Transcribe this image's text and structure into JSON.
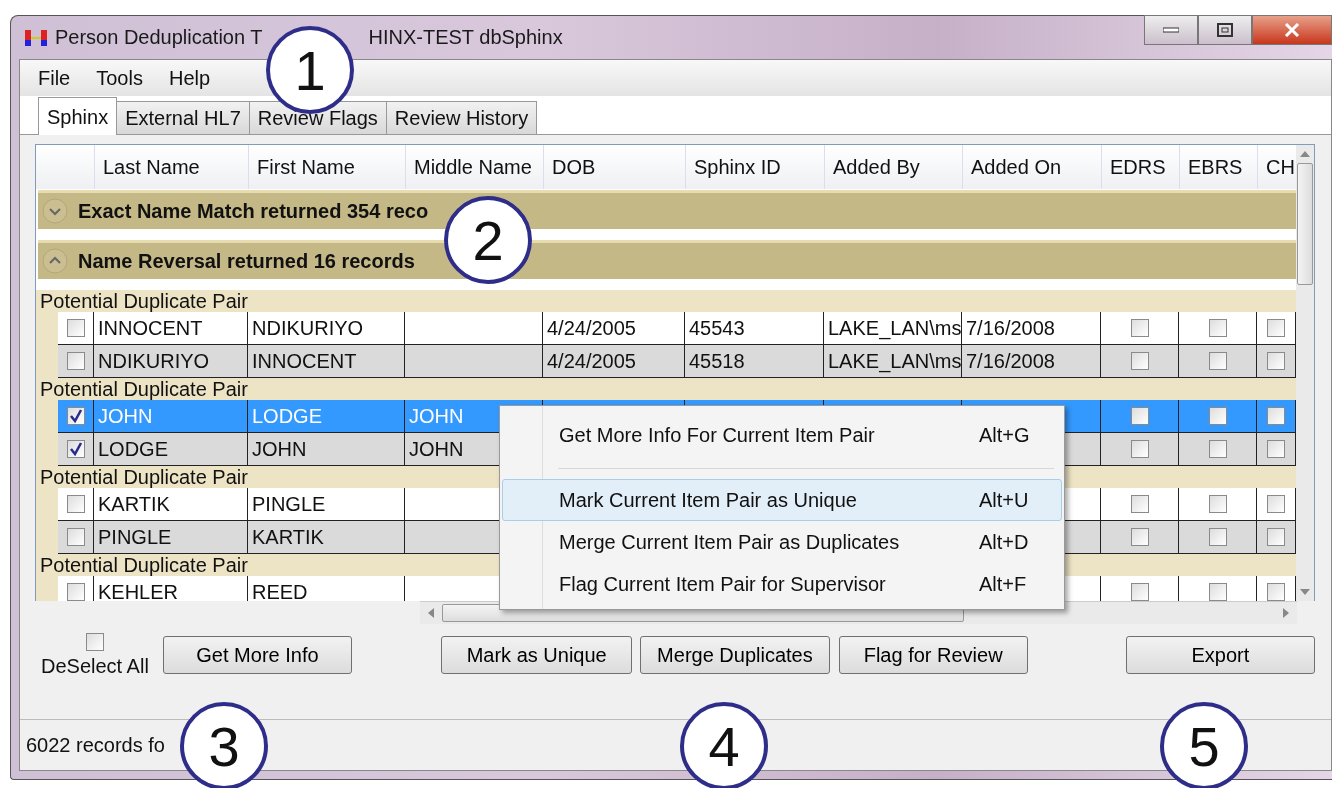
{
  "window": {
    "title_parts": [
      "Person Deduplication T",
      "HINX-TEST dbSphinx"
    ]
  },
  "menu": [
    "File",
    "Tools",
    "Help"
  ],
  "tabs": [
    {
      "label": "Sphinx",
      "selected": true
    },
    {
      "label": "External HL7",
      "selected": false
    },
    {
      "label": "Review Flags",
      "selected": false
    },
    {
      "label": "Review History",
      "selected": false
    }
  ],
  "grid": {
    "columns": [
      "Last Name",
      "First Name",
      "Middle Name",
      "DOB",
      "Sphinx ID",
      "Added By",
      "Added On",
      "EDRS",
      "EBRS",
      "CH"
    ],
    "groups": [
      {
        "title": "Exact Name Match returned 354 reco",
        "expanded": false
      },
      {
        "title": "Name Reversal returned 16 records",
        "expanded": true,
        "pairs": [
          {
            "label": "Potential Duplicate Pair",
            "rows": [
              {
                "checked": false,
                "selected": false,
                "last": "INNOCENT",
                "first": "NDIKURIYO",
                "dob": "4/24/2005",
                "id": "45543",
                "added_by": "LAKE_LAN\\ms",
                "added_on": "7/16/2008",
                "flags": [
                  {
                    "checked": false
                  },
                  {
                    "checked": false
                  },
                  {
                    "checked": false
                  }
                ]
              },
              {
                "checked": false,
                "selected": false,
                "last": "NDIKURIYO",
                "first": "INNOCENT",
                "dob": "4/24/2005",
                "id": "45518",
                "added_by": "LAKE_LAN\\ms",
                "added_on": "7/16/2008",
                "flags": [
                  {
                    "checked": false
                  },
                  {
                    "checked": false
                  },
                  {
                    "checked": false
                  }
                ]
              }
            ]
          },
          {
            "label": "Potential Duplicate Pair",
            "rows": [
              {
                "checked": true,
                "selected": true,
                "last": "JOHN",
                "first": "LODGE",
                "middle": "JOHN",
                "flags": [
                  {
                    "checked": false
                  },
                  {
                    "checked": false
                  },
                  {
                    "checked": false
                  }
                ]
              },
              {
                "checked": true,
                "selected": false,
                "last": "LODGE",
                "first": "JOHN",
                "middle": "JOHN",
                "flags": [
                  {
                    "checked": false
                  },
                  {
                    "checked": false
                  },
                  {
                    "checked": false
                  }
                ]
              }
            ]
          },
          {
            "label": "Potential Duplicate Pair",
            "rows": [
              {
                "checked": false,
                "selected": false,
                "last": "KARTIK",
                "first": "PINGLE",
                "flags": [
                  {
                    "checked": false
                  },
                  {
                    "checked": false
                  },
                  {
                    "checked": false
                  }
                ]
              },
              {
                "checked": false,
                "selected": false,
                "last": "PINGLE",
                "first": "KARTIK",
                "flags": [
                  {
                    "checked": false
                  },
                  {
                    "checked": false
                  },
                  {
                    "checked": false
                  }
                ]
              }
            ]
          },
          {
            "label": "Potential Duplicate Pair",
            "rows": [
              {
                "checked": false,
                "selected": false,
                "last": "KEHLER",
                "first": "REED",
                "flags": [
                  {
                    "checked": false
                  },
                  {
                    "checked": false
                  },
                  {
                    "checked": false
                  }
                ]
              }
            ]
          }
        ]
      }
    ]
  },
  "context_menu": {
    "items": [
      {
        "kind": "item",
        "label": "Get More Info For Current Item Pair",
        "shortcut": "Alt+G",
        "selected": false
      },
      {
        "kind": "separator"
      },
      {
        "kind": "item",
        "label": "Mark Current Item Pair as Unique",
        "shortcut": "Alt+U",
        "selected": true
      },
      {
        "kind": "item",
        "label": "Merge Current Item Pair as Duplicates",
        "shortcut": "Alt+D",
        "selected": false
      },
      {
        "kind": "item",
        "label": "Flag Current Item Pair for Supervisor",
        "shortcut": "Alt+F",
        "selected": false
      }
    ]
  },
  "deselect_all": {
    "label": "DeSelect All",
    "checked": false
  },
  "buttons": [
    "Get More Info",
    "Mark as Unique",
    "Merge Duplicates",
    "Flag for Review",
    "Export"
  ],
  "status_bar": "6022 records fo",
  "callouts": [
    "1",
    "2",
    "3",
    "4",
    "5"
  ]
}
